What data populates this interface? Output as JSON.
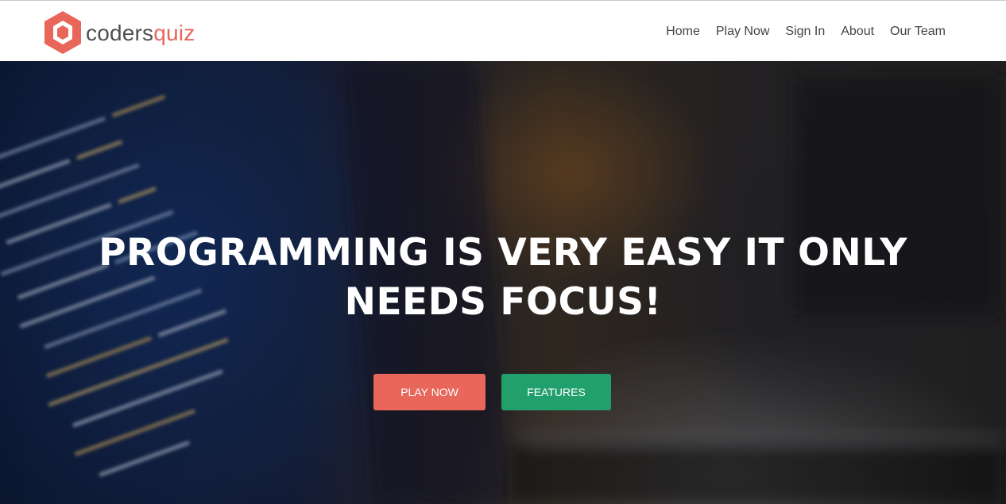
{
  "brand": {
    "name_part1": "coders",
    "name_part2": "quiz",
    "accent_color": "#e8665a",
    "logo_icon": "hexagon-logo-icon"
  },
  "nav": {
    "items": [
      {
        "label": "Home"
      },
      {
        "label": "Play Now"
      },
      {
        "label": "Sign In"
      },
      {
        "label": "About"
      },
      {
        "label": "Our Team"
      }
    ]
  },
  "hero": {
    "headline_line1": "PROGRAMMING IS VERY EASY IT ONLY",
    "headline_line2": "NEEDS FOCUS!",
    "primary_button": {
      "label": "PLAY NOW",
      "color": "#e8665a"
    },
    "secondary_button": {
      "label": "FEATURES",
      "color": "#22a06b"
    }
  }
}
